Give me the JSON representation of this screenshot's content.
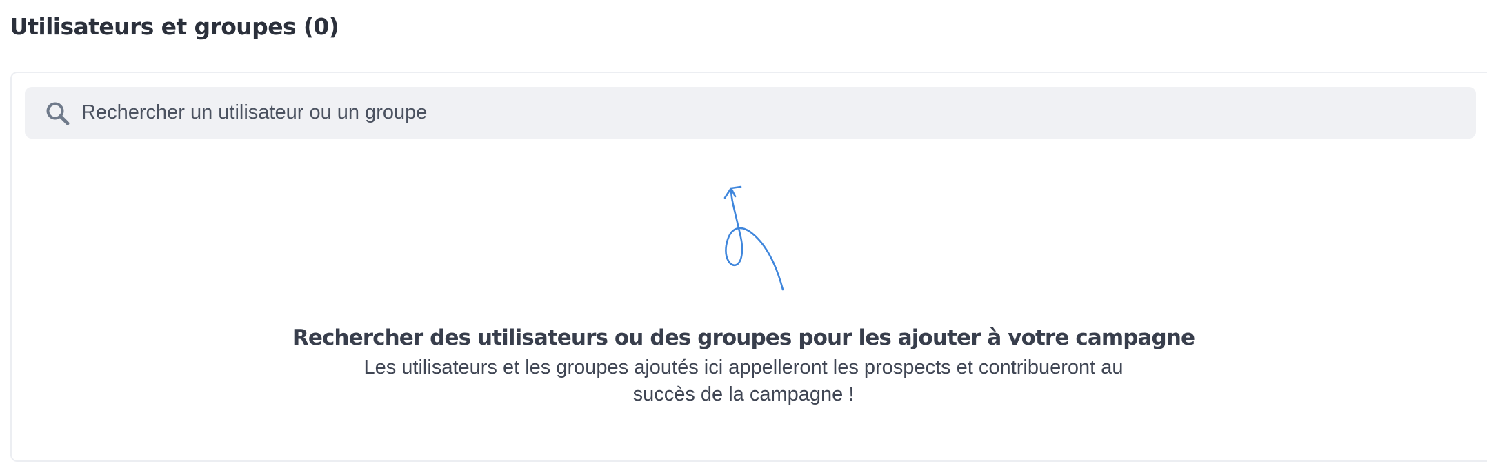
{
  "header": {
    "title": "Utilisateurs et groupes (0)"
  },
  "search": {
    "placeholder": "Rechercher un utilisateur ou un groupe",
    "value": "",
    "icon": "search-icon"
  },
  "empty_state": {
    "illustration": "curly-arrow-icon",
    "title": "Rechercher des utilisateurs ou des groupes pour les ajouter à votre campagne",
    "description": "Les utilisateurs et les groupes ajoutés ici appelleront les prospects et contribueront au succès de la campagne !"
  },
  "colors": {
    "arrow": "#3f86dc",
    "search_background": "#f0f1f4",
    "search_icon": "#6f7a8a",
    "panel_border": "#eceef2",
    "heading_text": "#2b303b"
  }
}
